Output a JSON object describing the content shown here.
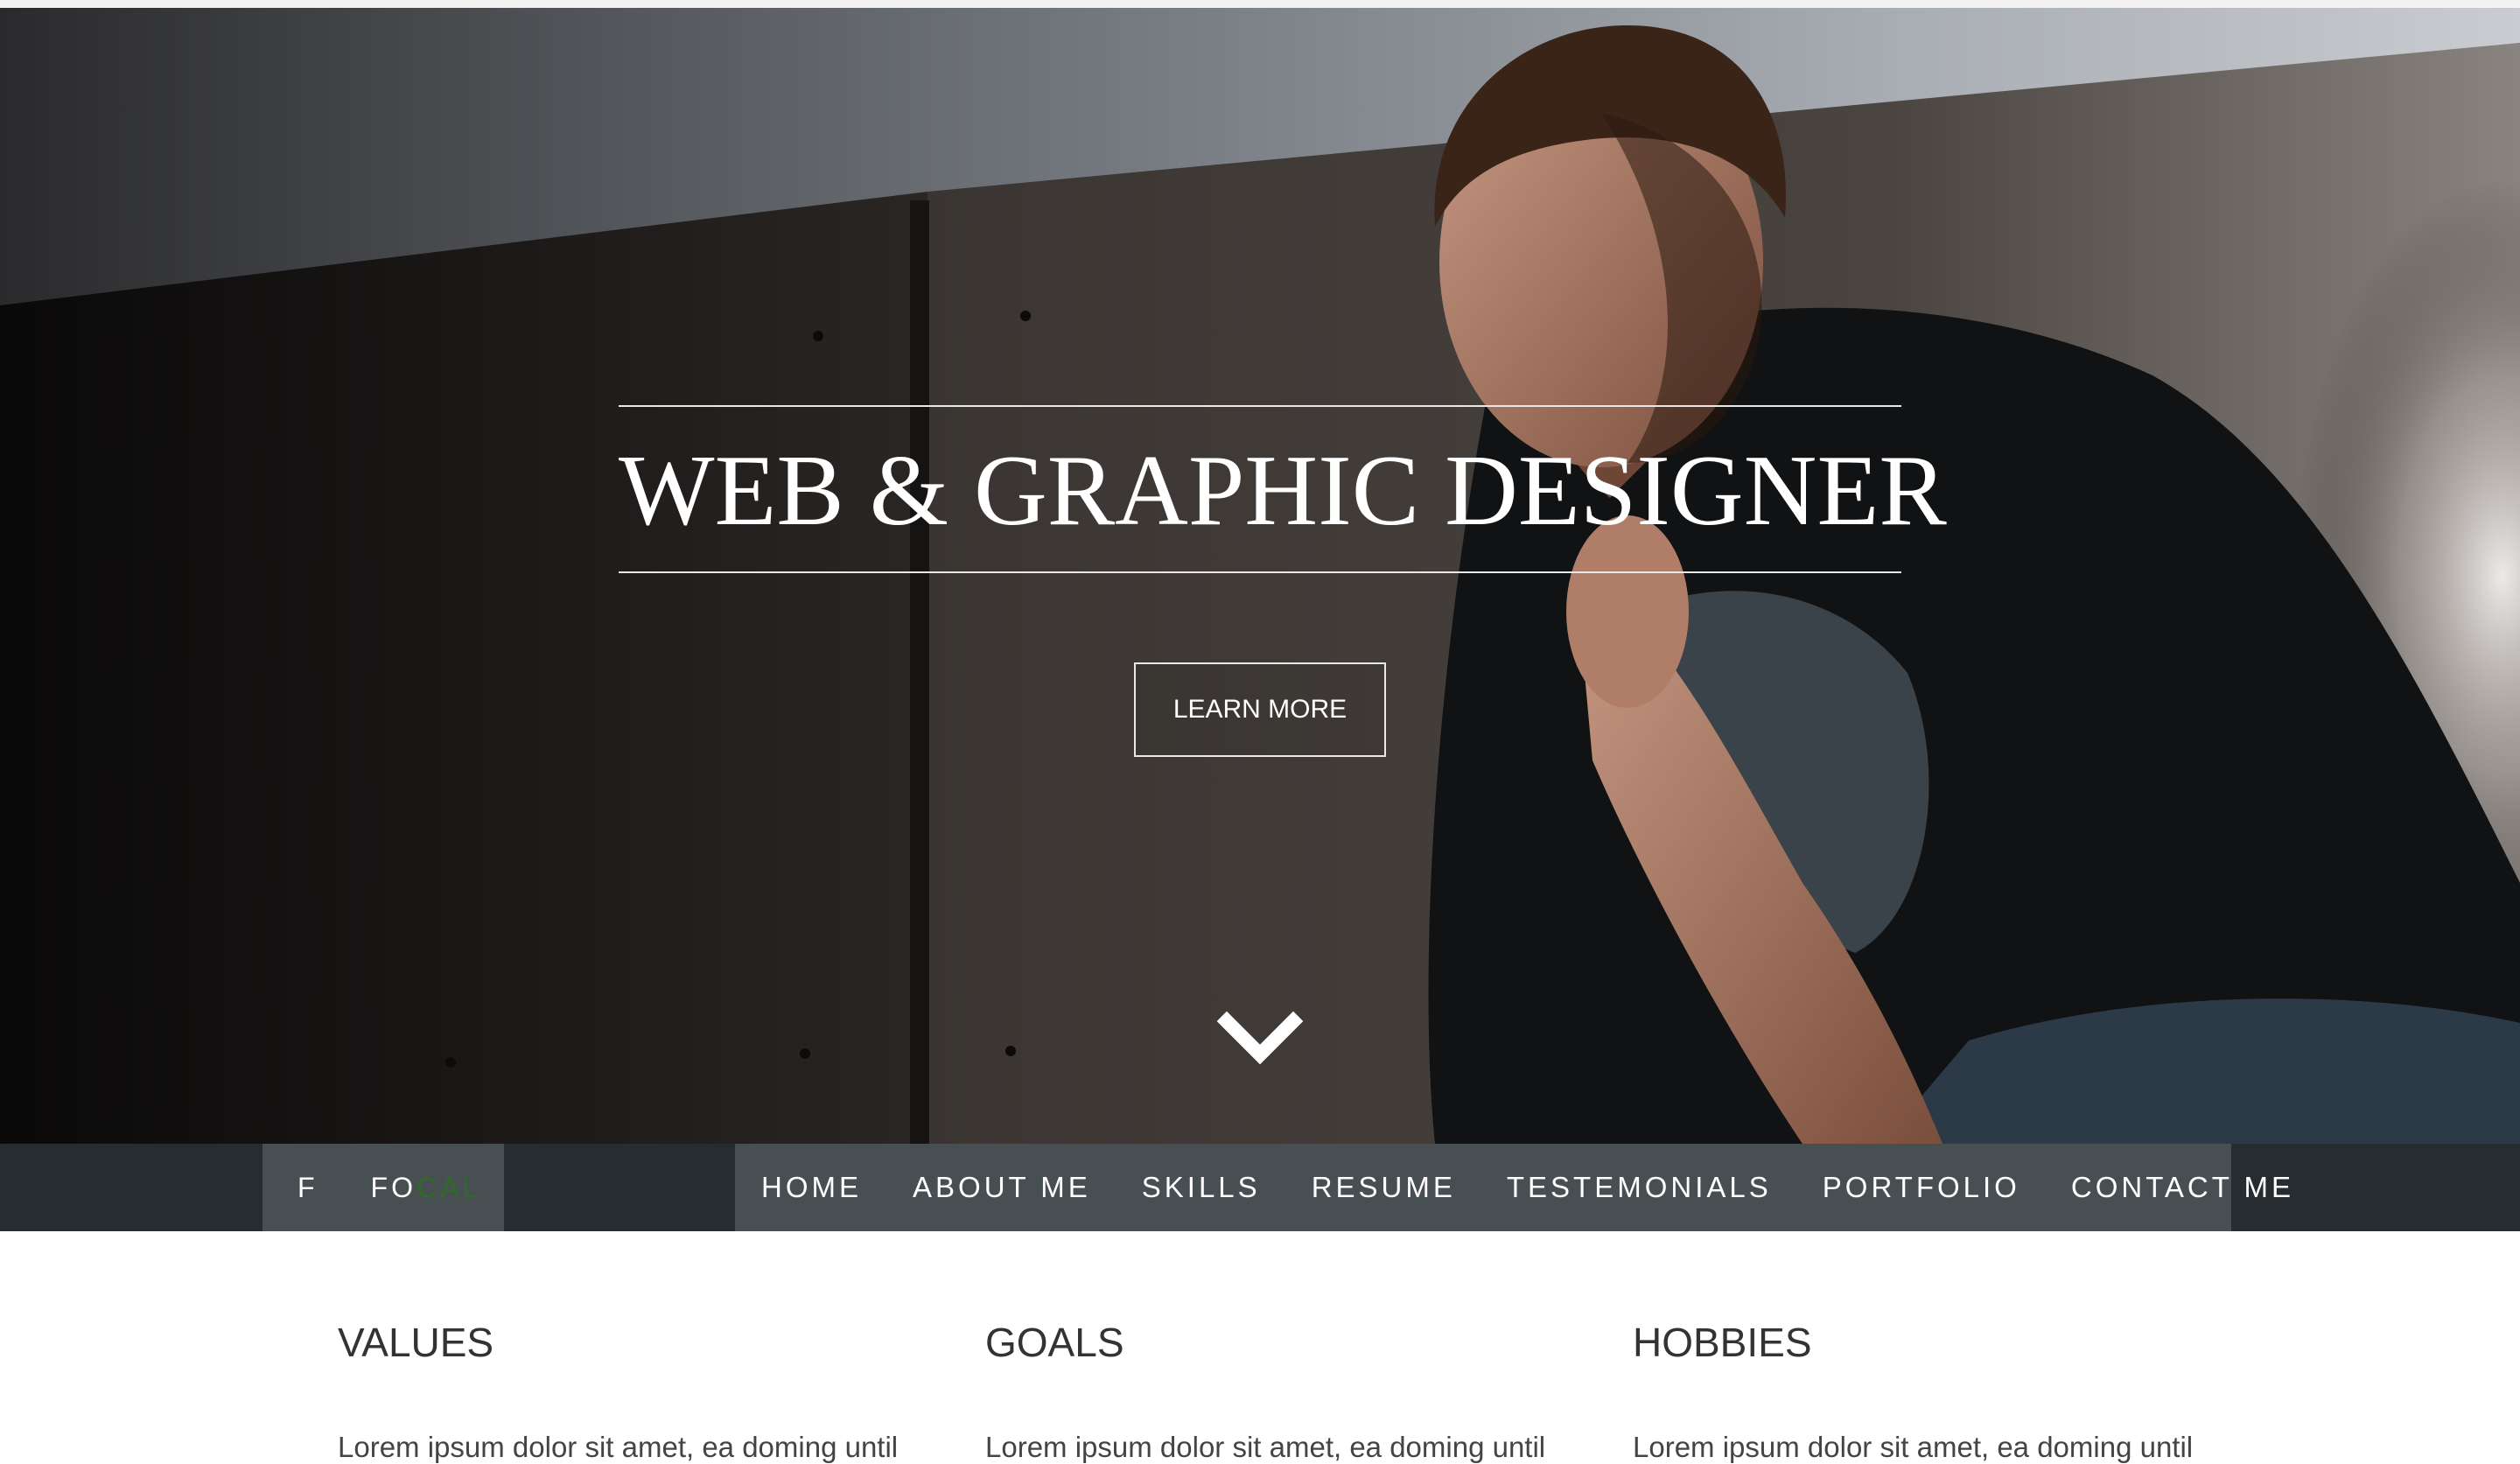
{
  "hero": {
    "headline": "WEB & GRAPHIC DESIGNER",
    "button_label": "LEARN MORE",
    "scroll_icon": "chevron-down-icon"
  },
  "nav": {
    "brand_initial": "F",
    "brand_prefix": "FO",
    "brand_accent": "CAL",
    "brand_accent_color": "#2f6b24",
    "items": [
      {
        "label": "HOME"
      },
      {
        "label": "ABOUT ME"
      },
      {
        "label": "SKILLS"
      },
      {
        "label": "RESUME"
      },
      {
        "label": "TESTEMONIALS"
      },
      {
        "label": "PORTFOLIO"
      },
      {
        "label": "CONTACT ME"
      }
    ]
  },
  "sections": [
    {
      "title": "VALUES",
      "text": "Lorem ipsum dolor sit amet, ea doming until"
    },
    {
      "title": "GOALS",
      "text": "Lorem ipsum dolor sit amet, ea doming until"
    },
    {
      "title": "HOBBIES",
      "text": "Lorem ipsum dolor sit amet, ea doming until"
    }
  ],
  "colors": {
    "nav_bg": "#262c2f",
    "nav_item_bg": "#484f52",
    "hero_bg": "#1b1918"
  }
}
